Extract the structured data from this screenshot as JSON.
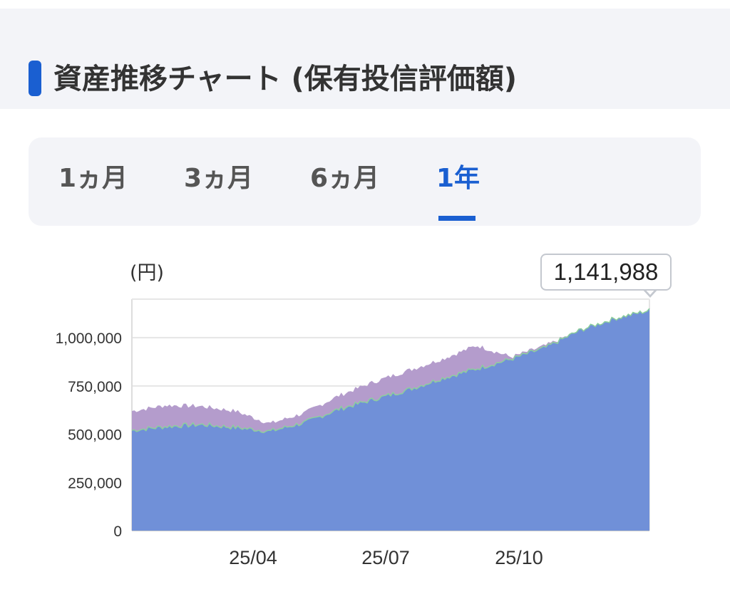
{
  "header": {
    "title": "資産推移チャート (保有投信評価額)"
  },
  "tabs": [
    {
      "label": "1ヵ月",
      "active": false
    },
    {
      "label": "3ヵ月",
      "active": false
    },
    {
      "label": "6ヵ月",
      "active": false
    },
    {
      "label": "1年",
      "active": true
    }
  ],
  "colors": {
    "accent": "#1a5fd1",
    "valuation_area": "#7090d8",
    "upper_area": "#b49ccc",
    "boundary_line": "#8ccf9c"
  },
  "chart_data": {
    "type": "area",
    "unit_label": "(円)",
    "ylim": [
      0,
      1200000
    ],
    "y_ticks": [
      0,
      250000,
      500000,
      750000,
      1000000
    ],
    "y_tick_labels": [
      "0",
      "250,000",
      "500,000",
      "750,000",
      "1,000,000"
    ],
    "x_tick_labels": [
      "25/04",
      "25/07",
      "25/10"
    ],
    "x": [
      "25/01",
      "25/02",
      "25/03",
      "25/03",
      "25/04",
      "25/04",
      "25/05",
      "25/06",
      "25/07",
      "25/08",
      "25/09",
      "25/09",
      "25/10",
      "25/11",
      "25/12",
      "25/12"
    ],
    "series": [
      {
        "values": [
          520000,
          540000,
          550000,
          535000,
          515000,
          560000,
          630000,
          680000,
          730000,
          790000,
          840000,
          890000,
          950000,
          1040000,
          1100000,
          1141988
        ]
      },
      {
        "values": [
          620000,
          650000,
          645000,
          620000,
          555000,
          610000,
          700000,
          770000,
          830000,
          890000,
          960000,
          900000,
          960000,
          1040000,
          1100000,
          1141988
        ]
      }
    ],
    "last_value_label": "1,141,988"
  }
}
